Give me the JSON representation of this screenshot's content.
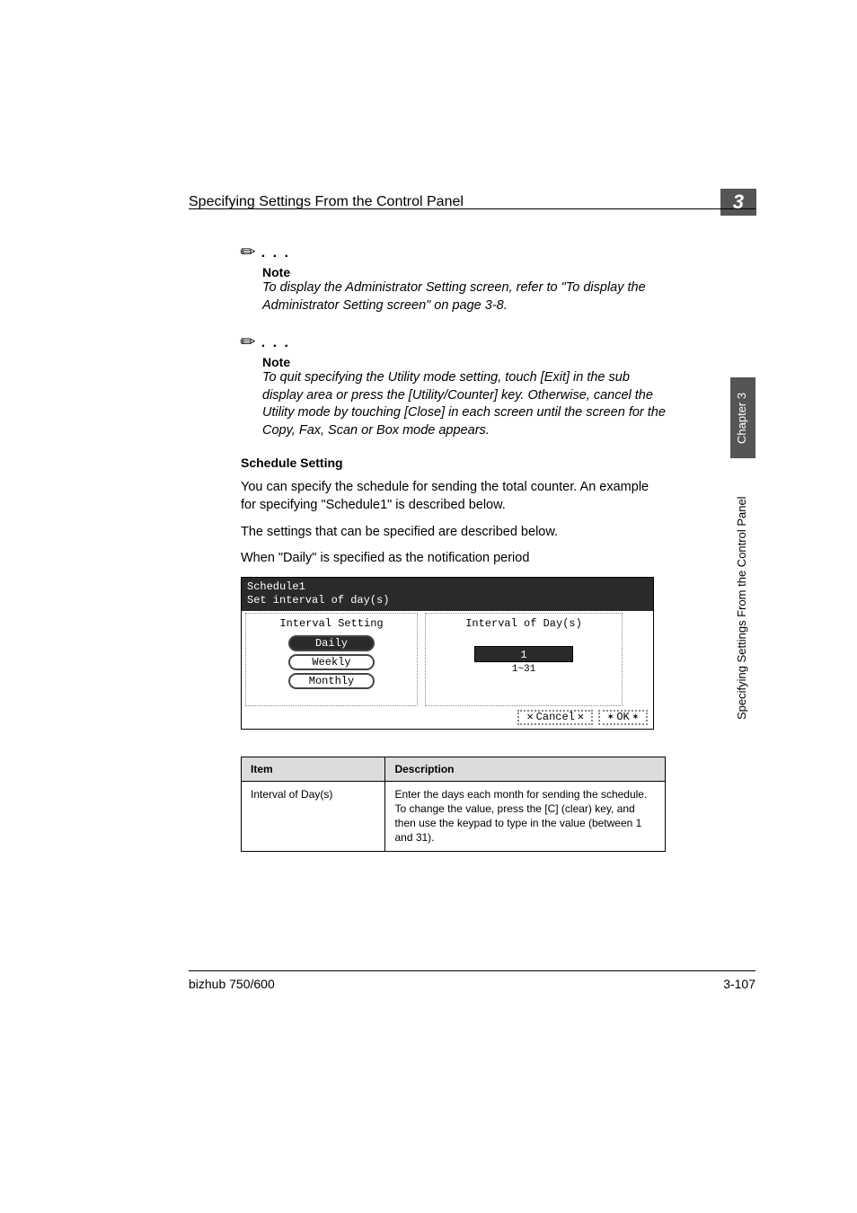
{
  "header": {
    "title": "Specifying Settings From the Control Panel",
    "chapter_num": "3"
  },
  "note1": {
    "label": "Note",
    "body": "To display the Administrator Setting screen, refer to \"To display the Administrator Setting screen\" on page 3-8."
  },
  "note2": {
    "label": "Note",
    "body": "To quit specifying the Utility mode setting, touch [Exit] in the sub display area or press the [Utility/Counter] key. Otherwise, cancel the Utility mode by touching [Close] in each screen until the screen for the Copy, Fax, Scan or Box mode appears."
  },
  "section": {
    "heading": "Schedule Setting",
    "para1": "You can specify the schedule for sending the total counter. An example for specifying \"Schedule1\" is described below.",
    "para2": "The settings that can be specified are described below.",
    "para3": "When \"Daily\" is specified as the notification period"
  },
  "panel": {
    "title_line1": "Schedule1",
    "title_line2": "Set interval of day(s)",
    "interval_setting_label": "Interval Setting",
    "daily": "Daily",
    "weekly": "Weekly",
    "monthly": "Monthly",
    "interval_ofday_label": "Interval of Day(s)",
    "value": "1",
    "range": "1~31",
    "cancel": "Cancel",
    "ok": "OK"
  },
  "table": {
    "header_item": "Item",
    "header_desc": "Description",
    "row1_item": "Interval of Day(s)",
    "row1_desc": "Enter the days each month for sending the schedule. To change the value, press the [C] (clear) key, and then use the keypad to type in the value (between 1 and 31)."
  },
  "sidebar": {
    "chapter": "Chapter 3",
    "section": "Specifying Settings From the Control Panel"
  },
  "footer": {
    "product": "bizhub 750/600",
    "page": "3-107"
  }
}
